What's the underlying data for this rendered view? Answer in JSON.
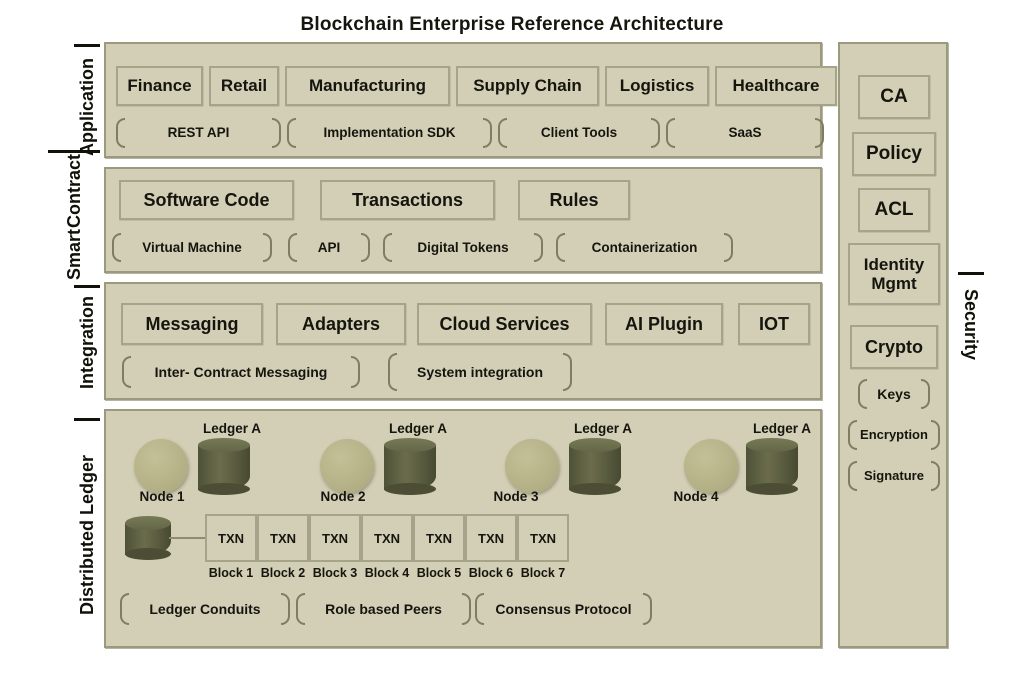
{
  "title": "Blockchain Enterprise Reference Architecture",
  "colors": {
    "panel_fill": "#d2cfb6",
    "panel_border": "#9b9a7d",
    "box_border": "#a6a488",
    "bracket_border": "#7e7d62",
    "node_circle": "#b6b389",
    "cylinder_body": "#5d6042",
    "text": "#15150e",
    "background": "#ffffff"
  },
  "layers": [
    {
      "id": "application",
      "label": "Application",
      "boxes": [
        "Finance",
        "Retail",
        "Manufacturing",
        "Supply Chain",
        "Logistics",
        "Healthcare"
      ],
      "brackets": [
        "REST API",
        "Implementation SDK",
        "Client Tools",
        "SaaS"
      ]
    },
    {
      "id": "smart-contract",
      "label": "Smart Contract",
      "label_lines": [
        "Smart",
        "Contract"
      ],
      "boxes": [
        "Software Code",
        "Transactions",
        "Rules"
      ],
      "brackets": [
        "Virtual Machine",
        "API",
        "Digital Tokens",
        "Containerization"
      ]
    },
    {
      "id": "integration",
      "label": "Integration",
      "boxes": [
        "Messaging",
        "Adapters",
        "Cloud Services",
        "AI Plugin",
        "IOT"
      ],
      "brackets": [
        "Inter- Contract  Messaging",
        "System integration"
      ]
    },
    {
      "id": "distributed-ledger",
      "label": "Distributed Ledger",
      "nodes": [
        {
          "node_label": "Node 1",
          "ledger_label": "Ledger A"
        },
        {
          "node_label": "Node 2",
          "ledger_label": "Ledger A"
        },
        {
          "node_label": "Node 3",
          "ledger_label": "Ledger A"
        },
        {
          "node_label": "Node 4",
          "ledger_label": "Ledger A"
        }
      ],
      "blocks": [
        {
          "content": "TXN",
          "label": "Block 1"
        },
        {
          "content": "TXN",
          "label": "Block 2"
        },
        {
          "content": "TXN",
          "label": "Block 3"
        },
        {
          "content": "TXN",
          "label": "Block 4"
        },
        {
          "content": "TXN",
          "label": "Block 5"
        },
        {
          "content": "TXN",
          "label": "Block 6"
        },
        {
          "content": "TXN",
          "label": "Block 7"
        }
      ],
      "brackets": [
        "Ledger Conduits",
        "Role based Peers",
        "Consensus Protocol"
      ]
    }
  ],
  "security": {
    "label": "Security",
    "boxes": [
      "CA",
      "Policy",
      "ACL",
      "Identity Mgmt",
      "Crypto"
    ],
    "box_lines": [
      [
        "CA"
      ],
      [
        "Policy"
      ],
      [
        "ACL"
      ],
      [
        "Identity",
        "Mgmt"
      ],
      [
        "Crypto"
      ]
    ],
    "brackets": [
      "Keys",
      "Encryption",
      "Signature"
    ]
  }
}
